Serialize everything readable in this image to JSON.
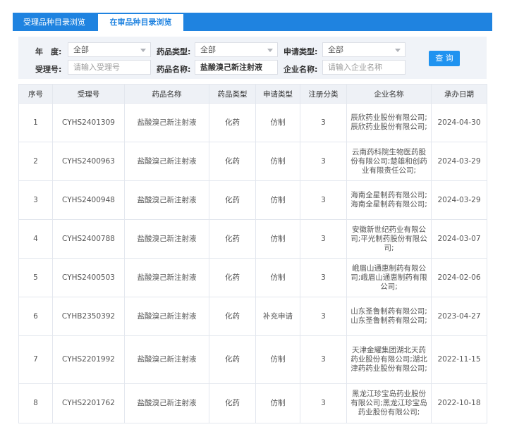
{
  "tabs": [
    {
      "label": "受理品种目录浏览"
    },
    {
      "label": "在审品种目录浏览"
    }
  ],
  "search": {
    "year_label": "年　度:",
    "year_value": "全部",
    "drug_type_label": "药品类型:",
    "drug_type_value": "全部",
    "apply_type_label": "申请类型:",
    "apply_type_value": "全部",
    "accept_no_label": "受理号:",
    "accept_no_placeholder": "请输入受理号",
    "drug_name_label": "药品名称:",
    "drug_name_value": "盐酸溴己新注射液",
    "company_label": "企业名称:",
    "company_placeholder": "请输入企业名称",
    "query_button": "查 询"
  },
  "table": {
    "headers": [
      "序号",
      "受理号",
      "药品名称",
      "药品类型",
      "申请类型",
      "注册分类",
      "企业名称",
      "承办日期"
    ],
    "rows": [
      {
        "no": "1",
        "accept_no": "CYHS2401309",
        "drug_name": "盐酸溴己新注射液",
        "drug_type": "化药",
        "apply_type": "仿制",
        "reg_class": "3",
        "company": "辰欣药业股份有限公司;辰欣药业股份有限公司;",
        "date": "2024-04-30"
      },
      {
        "no": "2",
        "accept_no": "CYHS2400963",
        "drug_name": "盐酸溴己新注射液",
        "drug_type": "化药",
        "apply_type": "仿制",
        "reg_class": "3",
        "company": "云南药科院生物医药股份有限公司;楚雄和创药业有限责任公司;",
        "date": "2024-03-29"
      },
      {
        "no": "3",
        "accept_no": "CYHS2400948",
        "drug_name": "盐酸溴己新注射液",
        "drug_type": "化药",
        "apply_type": "仿制",
        "reg_class": "3",
        "company": "海南全星制药有限公司;海南全星制药有限公司;",
        "date": "2024-03-29"
      },
      {
        "no": "4",
        "accept_no": "CYHS2400788",
        "drug_name": "盐酸溴己新注射液",
        "drug_type": "化药",
        "apply_type": "仿制",
        "reg_class": "3",
        "company": "安徽新世纪药业有限公司;平光制药股份有限公司;",
        "date": "2024-03-07"
      },
      {
        "no": "5",
        "accept_no": "CYHS2400503",
        "drug_name": "盐酸溴己新注射液",
        "drug_type": "化药",
        "apply_type": "仿制",
        "reg_class": "3",
        "company": "峨眉山通惠制药有限公司;峨眉山通惠制药有限公司;",
        "date": "2024-02-06"
      },
      {
        "no": "6",
        "accept_no": "CYHB2350392",
        "drug_name": "盐酸溴己新注射液",
        "drug_type": "化药",
        "apply_type": "补充申请",
        "reg_class": "3",
        "company": "山东圣鲁制药有限公司;山东圣鲁制药有限公司;",
        "date": "2023-04-27"
      },
      {
        "no": "7",
        "accept_no": "CYHS2201992",
        "drug_name": "盐酸溴己新注射液",
        "drug_type": "化药",
        "apply_type": "仿制",
        "reg_class": "3",
        "company": "天津金耀集团湖北天药药业股份有限公司;湖北津药药业股份有限公司;",
        "date": "2022-11-15"
      },
      {
        "no": "8",
        "accept_no": "CYHS2201762",
        "drug_name": "盐酸溴己新注射液",
        "drug_type": "化药",
        "apply_type": "仿制",
        "reg_class": "3",
        "company": "黑龙江珍宝岛药业股份有限公司;黑龙江珍宝岛药业股份有限公司;",
        "date": "2022-10-18"
      }
    ]
  }
}
